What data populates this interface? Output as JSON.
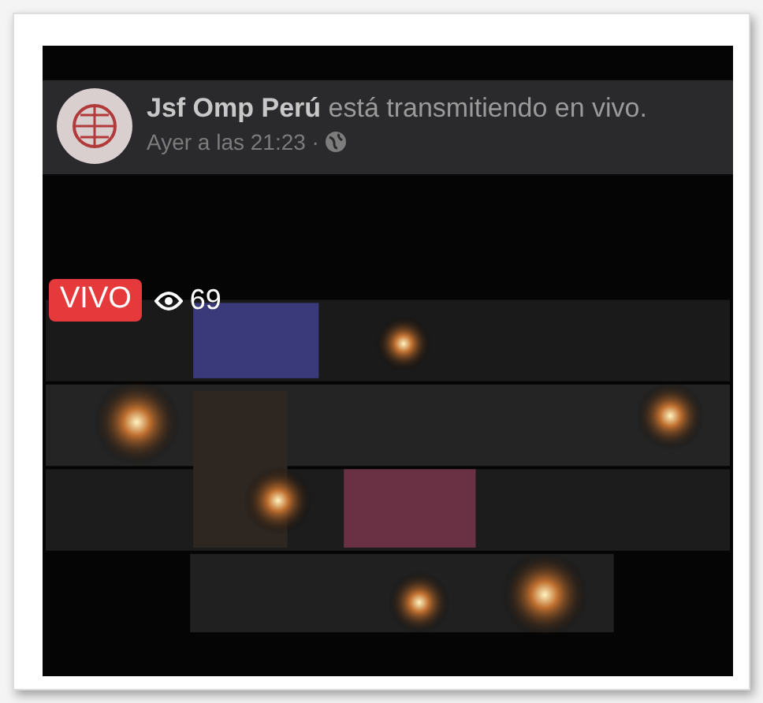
{
  "post": {
    "headline": "**Jsf Omp Perú** está transmitiendo en vivo.",
    "time": "Ayer a las 21:23 ·"
  },
  "live": {
    "badge": "VIVO",
    "viewers": "69"
  }
}
